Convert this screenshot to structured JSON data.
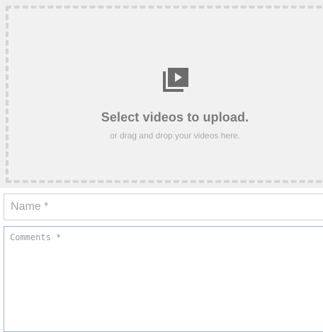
{
  "upload": {
    "title": "Select videos to upload.",
    "subtitle": "or drag and drop your videos here.",
    "icon": "video-library-icon"
  },
  "form": {
    "name_placeholder": "Name *",
    "name_value": "",
    "comments_placeholder": "Comments *",
    "comments_value": ""
  },
  "colors": {
    "dropzone_bg": "#f1f1f1",
    "dropzone_border": "#d4d4d4",
    "title_text": "#7b7b7b",
    "subtitle_text": "#a9a9a9",
    "focus_border": "#9fb0d8"
  }
}
